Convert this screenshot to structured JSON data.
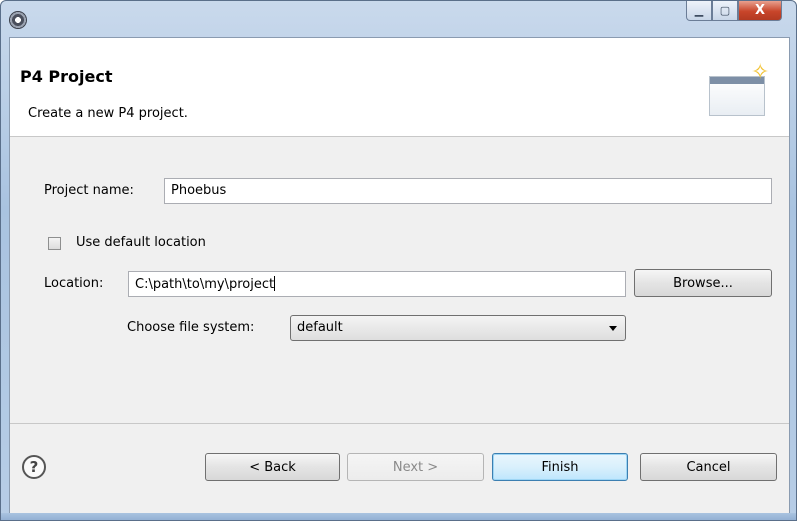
{
  "window": {
    "title": "",
    "minimize_glyph": "▁",
    "maximize_glyph": "▢",
    "close_glyph": "X"
  },
  "header": {
    "title": "P4 Project",
    "description": "Create a new P4 project."
  },
  "form": {
    "project_name_label": "Project name:",
    "project_name_value": "Phoebus",
    "use_default_location_label": "Use default location",
    "use_default_location_checked": false,
    "location_label": "Location:",
    "location_value": "C:\\path\\to\\my\\project",
    "browse_label": "Browse...",
    "file_system_label": "Choose file system:",
    "file_system_value": "default"
  },
  "footer": {
    "help_glyph": "?",
    "back_label": "< Back",
    "next_label": "Next >",
    "finish_label": "Finish",
    "cancel_label": "Cancel"
  },
  "icons": {
    "app": "eclipse-icon",
    "banner": "new-project-wizard-icon",
    "help": "help-icon"
  },
  "colors": {
    "title_bar": "#b7cde6",
    "close_button": "#c8452a",
    "default_button": "#bee6fd"
  }
}
